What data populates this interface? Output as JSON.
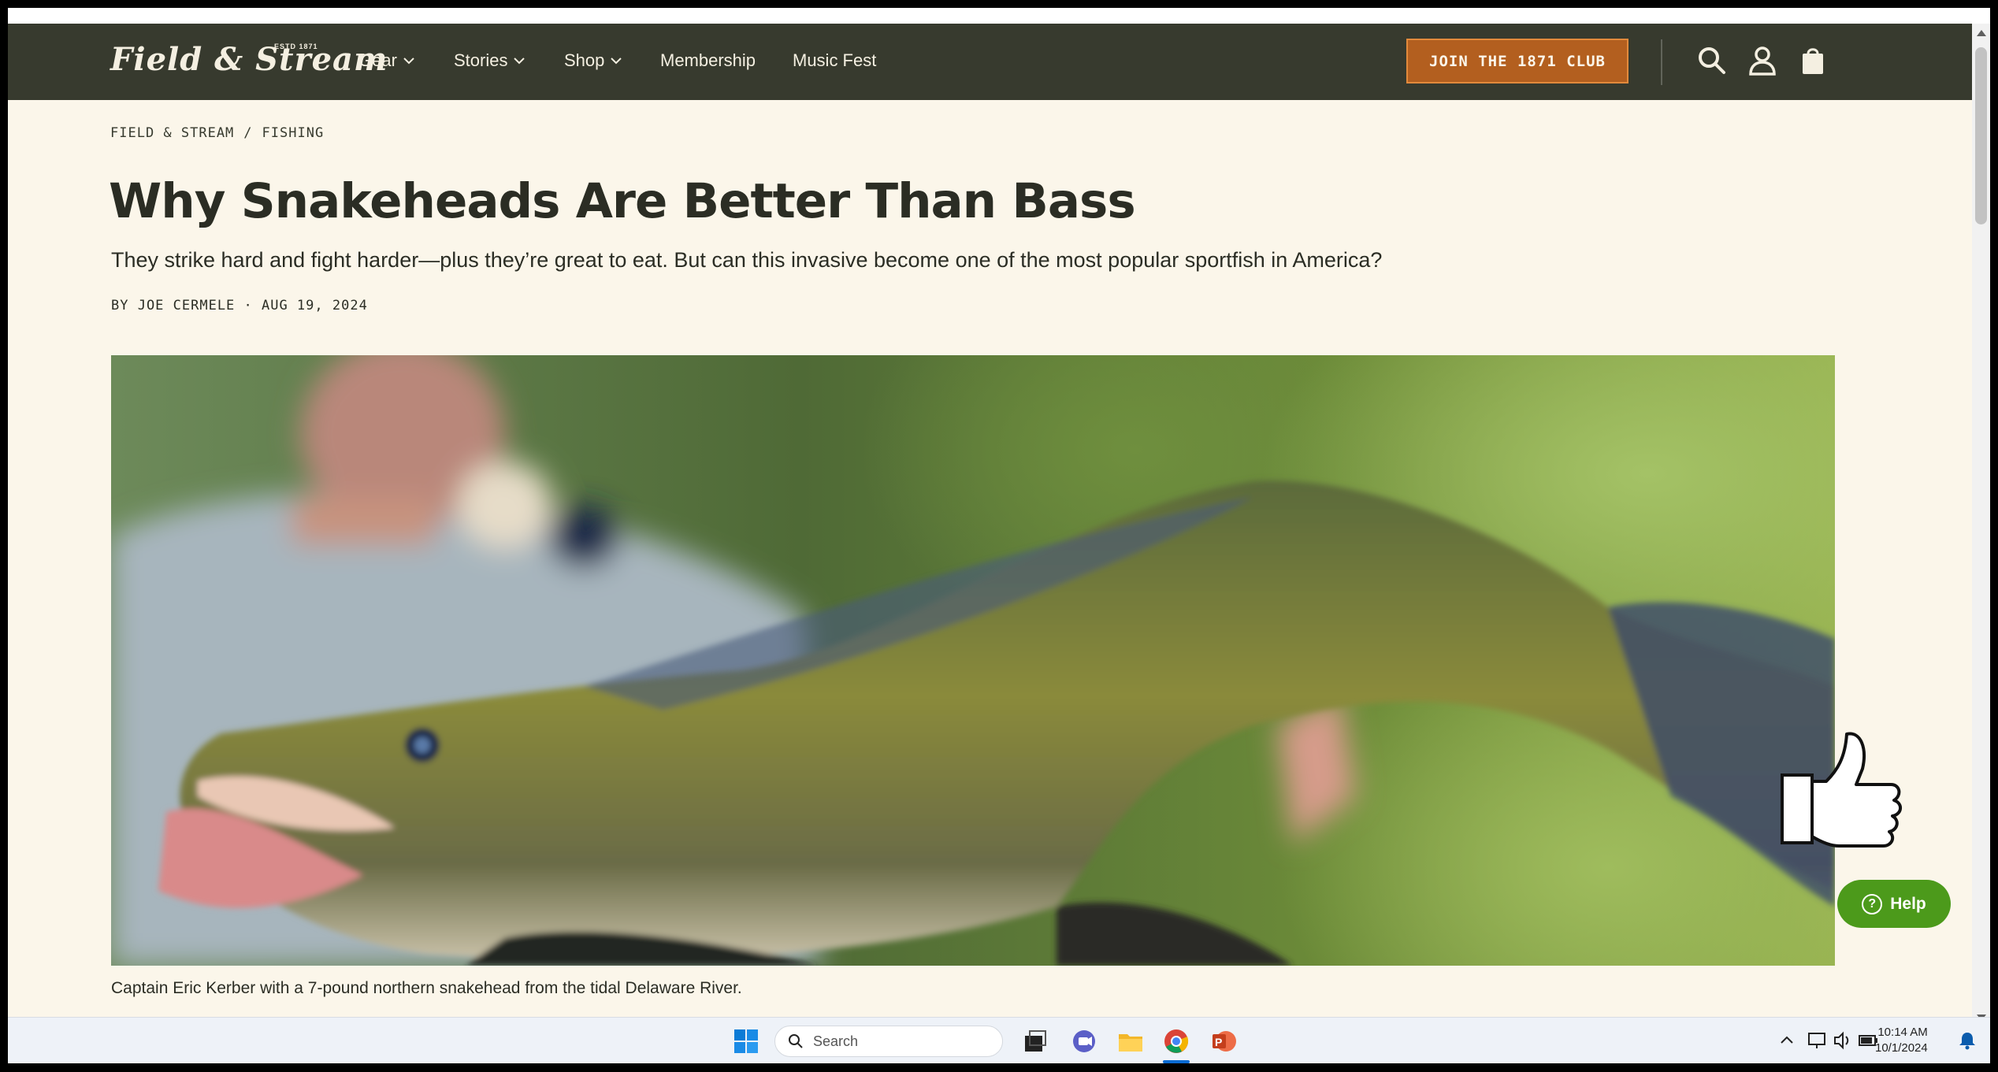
{
  "nav": {
    "logo": "Field & Stream",
    "logo_est": "ESTD 1871",
    "items": [
      {
        "label": "Gear"
      },
      {
        "label": "Stories"
      },
      {
        "label": "Shop"
      },
      {
        "label": "Membership"
      },
      {
        "label": "Music Fest"
      }
    ],
    "cta": "JOIN THE 1871 CLUB"
  },
  "article": {
    "breadcrumb": [
      "FIELD & STREAM",
      "/",
      "FISHING"
    ],
    "title": "Why Snakeheads Are Better Than Bass",
    "dek": "They strike hard and fight harder—plus they’re great to eat. But can this invasive become one of the most popular sportfish in America?",
    "byline": "BY JOE CERMELE · AUG 19, 2024",
    "caption": "Captain Eric Kerber with a 7-pound northern snakehead from the tidal Delaware River."
  },
  "help": {
    "label": "Help",
    "icon_glyph": "?"
  },
  "taskbar": {
    "search_placeholder": "Search",
    "time": "10:14 AM",
    "date": "10/1/2024"
  },
  "colors": {
    "nav_bg": "#373a2e",
    "page_bg": "#fbf6ea",
    "cta_bg": "#b35f1f",
    "help_bg": "#4c9a1b"
  }
}
